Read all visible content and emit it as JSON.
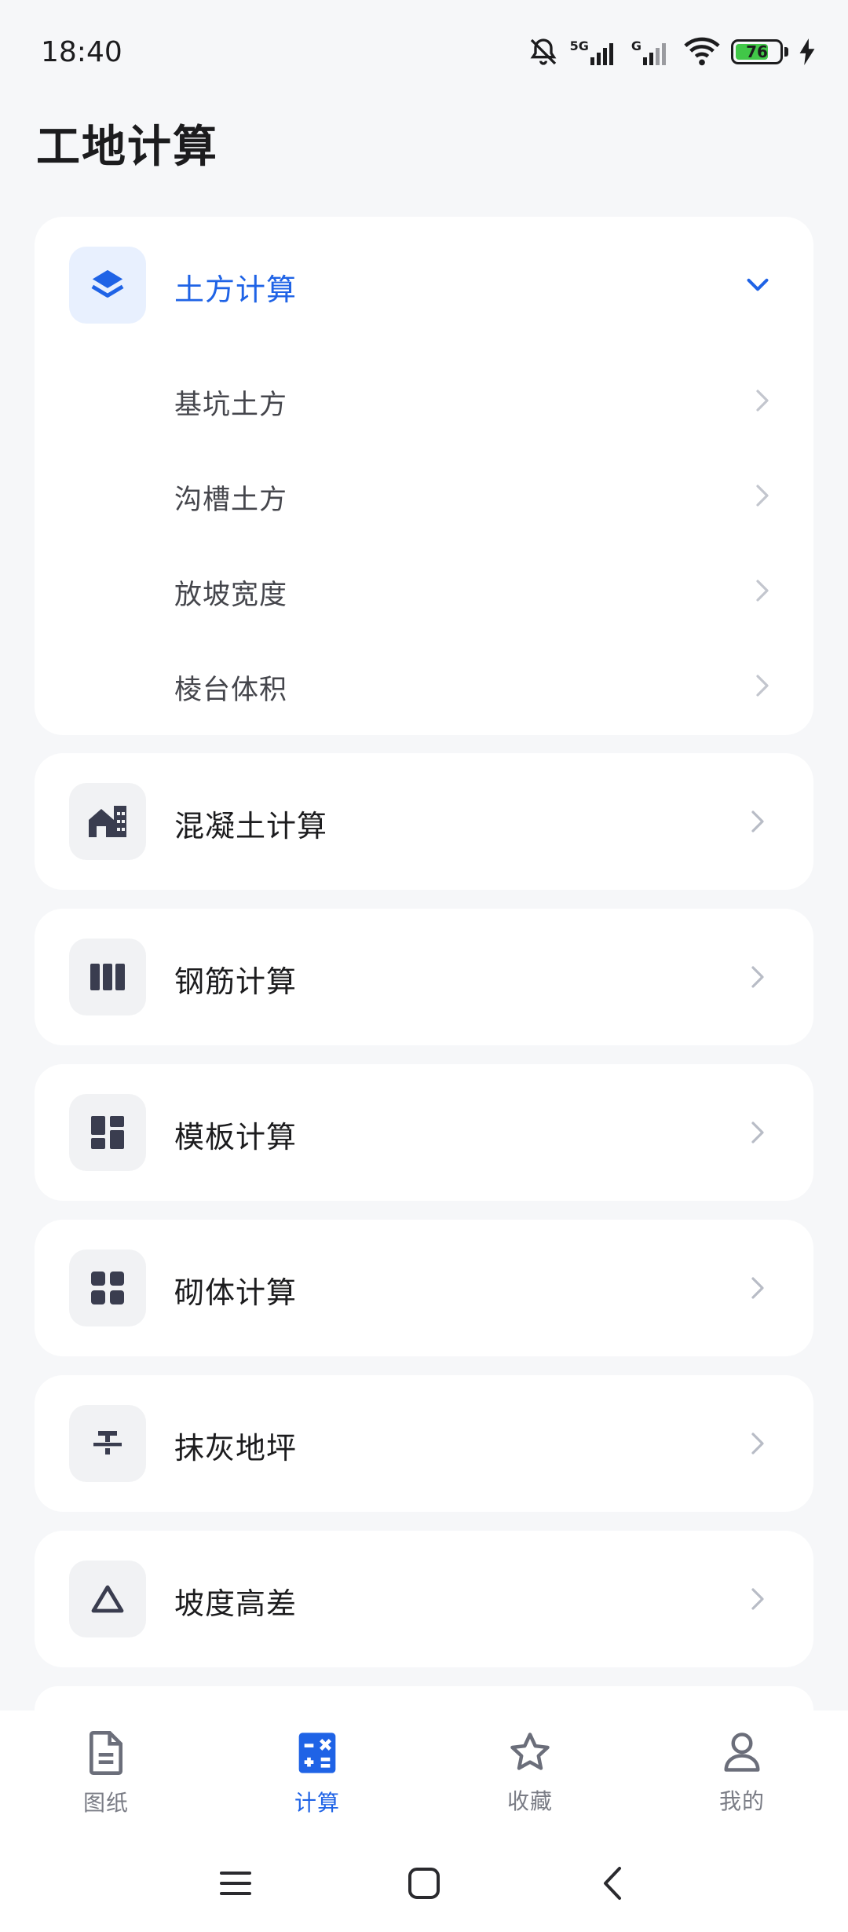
{
  "status_bar": {
    "time": "18:40",
    "network_5g": "5G",
    "network_g": "G",
    "battery_level": "76",
    "battery_fraction": 0.76
  },
  "header": {
    "title": "工地计算"
  },
  "sections": [
    {
      "label": "土方计算",
      "icon": "layers-icon",
      "expanded": true,
      "items": [
        {
          "label": "基坑土方"
        },
        {
          "label": "沟槽土方"
        },
        {
          "label": "放坡宽度"
        },
        {
          "label": "棱台体积"
        }
      ]
    },
    {
      "label": "混凝土计算",
      "icon": "building-icon"
    },
    {
      "label": "钢筋计算",
      "icon": "rebar-columns-icon"
    },
    {
      "label": "模板计算",
      "icon": "dashboard-blocks-icon"
    },
    {
      "label": "砌体计算",
      "icon": "grid-blocks-icon"
    },
    {
      "label": "抹灰地坪",
      "icon": "strikethrough-icon"
    },
    {
      "label": "坡度高差",
      "icon": "triangle-icon"
    }
  ],
  "bottom_nav": {
    "items": [
      {
        "label": "图纸",
        "icon": "document-icon",
        "active": false
      },
      {
        "label": "计算",
        "icon": "calculator-icon",
        "active": true
      },
      {
        "label": "收藏",
        "icon": "star-icon",
        "active": false
      },
      {
        "label": "我的",
        "icon": "person-icon",
        "active": false
      }
    ]
  },
  "colors": {
    "accent": "#1f63e6",
    "background": "#f6f7f9",
    "card": "#ffffff",
    "icon_dark": "#3a3d4f",
    "chevron": "#b8bcc6"
  }
}
